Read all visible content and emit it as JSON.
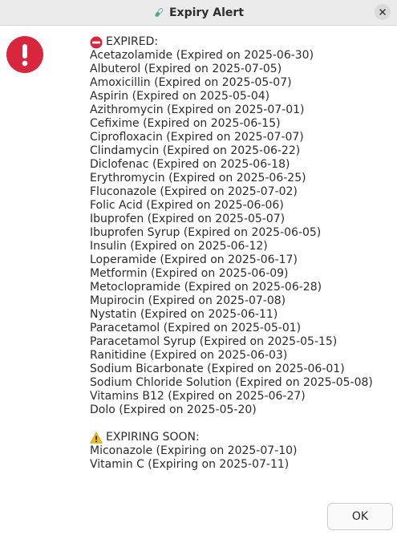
{
  "window": {
    "title": "Expiry Alert",
    "title_icon": "test-tube-icon"
  },
  "expired": {
    "header": "EXPIRED:",
    "icon": "no-entry-icon",
    "items": [
      "Acetazolamide (Expired on 2025-06-30)",
      "Albuterol (Expired on 2025-07-05)",
      "Amoxicillin (Expired on 2025-05-07)",
      "Aspirin (Expired on 2025-05-04)",
      "Azithromycin (Expired on 2025-07-01)",
      "Cefixime (Expired on 2025-06-15)",
      "Ciprofloxacin (Expired on 2025-07-07)",
      "Clindamycin (Expired on 2025-06-22)",
      "Diclofenac (Expired on 2025-06-18)",
      "Erythromycin (Expired on 2025-06-25)",
      "Fluconazole (Expired on 2025-07-02)",
      "Folic Acid (Expired on 2025-06-06)",
      "Ibuprofen (Expired on 2025-05-07)",
      "Ibuprofen Syrup (Expired on 2025-06-05)",
      "Insulin (Expired on 2025-06-12)",
      "Loperamide (Expired on 2025-06-17)",
      "Metformin (Expired on 2025-06-09)",
      "Metoclopramide (Expired on 2025-06-28)",
      "Mupirocin (Expired on 2025-07-08)",
      "Nystatin (Expired on 2025-06-11)",
      "Paracetamol (Expired on 2025-05-01)",
      "Paracetamol Syrup (Expired on 2025-05-15)",
      "Ranitidine (Expired on 2025-06-03)",
      "Sodium Bicarbonate (Expired on 2025-06-01)",
      "Sodium Chloride Solution (Expired on 2025-05-08)",
      "Vitamins B12 (Expired on 2025-06-27)",
      "Dolo (Expired on 2025-05-20)"
    ]
  },
  "expiring": {
    "header": "EXPIRING SOON:",
    "icon": "warning-icon",
    "items": [
      "Miconazole (Expiring on 2025-07-10)",
      "Vitamin C (Expiring on 2025-07-11)"
    ]
  },
  "buttons": {
    "ok": "OK"
  },
  "colors": {
    "alert_red": "#d8263c",
    "warning_yellow": "#f2b90f"
  }
}
